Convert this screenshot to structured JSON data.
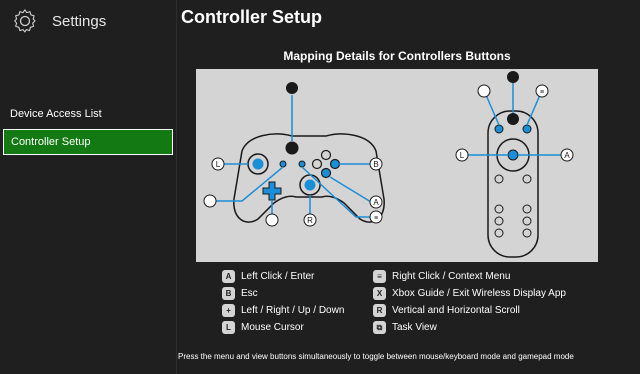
{
  "sidebar": {
    "header_label": "Settings",
    "items": [
      {
        "label": "Device Access List",
        "active": false
      },
      {
        "label": "Controller Setup",
        "active": true
      }
    ]
  },
  "main": {
    "title": "Controller Setup",
    "mapping_title": "Mapping Details for Controllers Buttons",
    "diagram_glyphs": {
      "a": "A",
      "b": "B",
      "l": "L",
      "r": "R",
      "menu": "≡"
    },
    "legend_left": [
      {
        "glyph": "A",
        "icon": "a-button-icon",
        "label": "Left Click / Enter"
      },
      {
        "glyph": "B",
        "icon": "b-button-icon",
        "label": "Esc"
      },
      {
        "glyph": "+",
        "icon": "dpad-icon",
        "label": "Left / Right / Up / Down"
      },
      {
        "glyph": "L",
        "icon": "left-stick-icon",
        "label": "Mouse Cursor"
      }
    ],
    "legend_right": [
      {
        "glyph": "≡",
        "icon": "menu-button-icon",
        "label": "Right Click / Context Menu"
      },
      {
        "glyph": "X",
        "icon": "xbox-button-icon",
        "label": "Xbox Guide / Exit Wireless Display App"
      },
      {
        "glyph": "R",
        "icon": "right-stick-icon",
        "label": "Vertical and Horizontal Scroll"
      },
      {
        "glyph": "⧉",
        "icon": "view-button-icon",
        "label": "Task View"
      }
    ],
    "footnote": "Press the menu and view buttons simultaneously to toggle between mouse/keyboard mode and gamepad mode"
  },
  "colors": {
    "background": "#1f1f1f",
    "accent": "#137a13",
    "diagram_bg": "#d4d4d4",
    "callout": "#1a8fd8"
  }
}
